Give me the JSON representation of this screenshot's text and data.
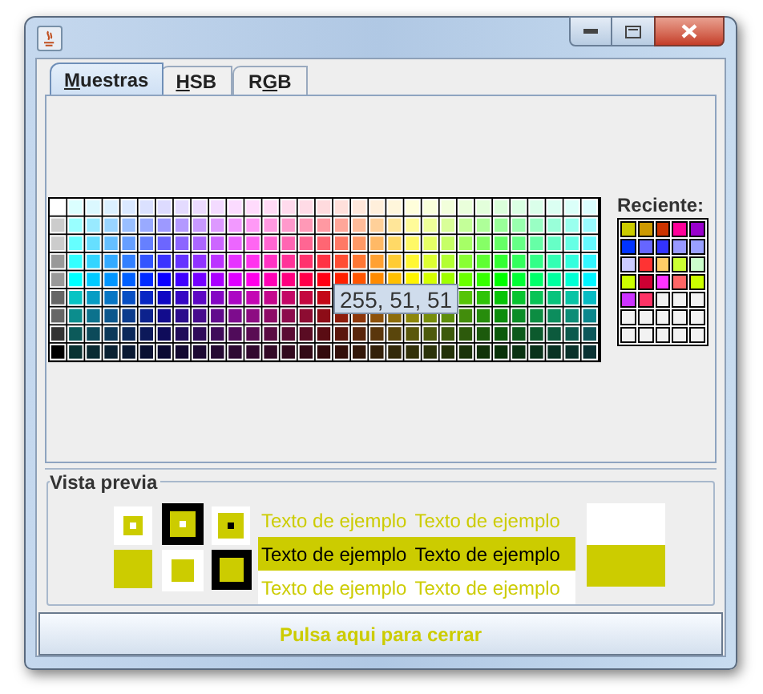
{
  "tabs": [
    {
      "mnemonic": "M",
      "label_end": "uestras",
      "selected": true
    },
    {
      "mnemonic": "H",
      "label_end": "SB",
      "selected": false
    },
    {
      "label_start": "R",
      "mnemonic": "G",
      "label_end": "B",
      "selected": false
    }
  ],
  "swatches": {
    "tooltip": "255, 51, 51"
  },
  "recent": {
    "label": "Reciente:",
    "colors": [
      {
        "color": "#cccc00"
      },
      {
        "color": "#cc9900"
      },
      {
        "color": "#cc3300"
      },
      {
        "color": "#ff0099"
      },
      {
        "color": "#9900cc"
      },
      {
        "color": "#0033ff"
      },
      {
        "color": "#6666ff"
      },
      {
        "color": "#3333ff"
      },
      {
        "color": "#9999ff"
      },
      {
        "color": "#99a0ff"
      },
      {
        "color": "#ccccff"
      },
      {
        "color": "#ff3333"
      },
      {
        "color": "#ffcc66"
      },
      {
        "color": "#ccff33"
      },
      {
        "color": "#ccffcc"
      },
      {
        "color": "#ccff00"
      },
      {
        "color": "#cc0033"
      },
      {
        "color": "#ff33ff"
      },
      {
        "color": "#ff6666"
      },
      {
        "color": "#ccff00"
      },
      {
        "color": "#cc33ff"
      },
      {
        "color": "#ff3366"
      }
    ]
  },
  "preview": {
    "title": "Vista previa",
    "color": "#cccc00",
    "samples": [
      [
        "Texto de ejemplo",
        "Texto de ejemplo"
      ],
      [
        "Texto de ejemplo",
        "Texto de ejemplo"
      ],
      [
        "Texto de ejemplo",
        "Texto de ejemplo"
      ]
    ]
  },
  "close_button": {
    "label": "Pulsa aqui para cerrar"
  }
}
